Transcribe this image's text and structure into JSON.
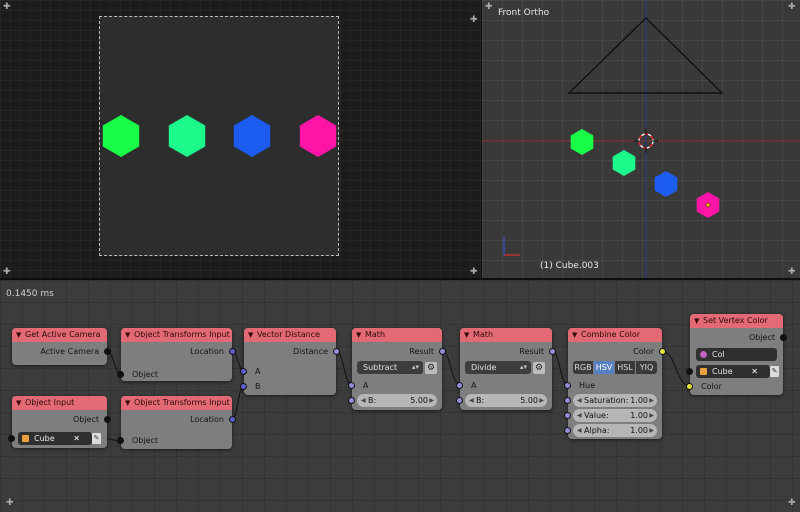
{
  "viewport_camera": {
    "hexagon_colors": [
      "#19ff47",
      "#1bfa8a",
      "#1c5cf0",
      "#ff14a8"
    ]
  },
  "viewport_ortho": {
    "view_label": "Front Ortho",
    "object_label": "(1) Cube.003",
    "hexagon_colors": [
      "#19ff47",
      "#1bfa8a",
      "#1c5cf0",
      "#ff14a8"
    ]
  },
  "node_editor": {
    "timing": "0.1450 ms",
    "nodes": {
      "get_active_camera": {
        "title": "Get Active Camera",
        "output": "Active Camera"
      },
      "object_input": {
        "title": "Object Input",
        "output": "Object",
        "object_value": "Cube"
      },
      "transforms_1": {
        "title": "Object Transforms Input",
        "output": "Location",
        "input": "Object"
      },
      "transforms_2": {
        "title": "Object Transforms Input",
        "output": "Location",
        "input": "Object"
      },
      "vector_distance": {
        "title": "Vector Distance",
        "output": "Distance",
        "input_a": "A",
        "input_b": "B"
      },
      "math_subtract": {
        "title": "Math",
        "output": "Result",
        "operation": "Subtract",
        "input_a": "A",
        "input_b_label": "B:",
        "input_b_value": "5.00"
      },
      "math_divide": {
        "title": "Math",
        "output": "Result",
        "operation": "Divide",
        "input_a": "A",
        "input_b_label": "B:",
        "input_b_value": "5.00"
      },
      "combine_color": {
        "title": "Combine Color",
        "output": "Color",
        "modes": [
          "RGB",
          "HSV",
          "HSL",
          "YIQ"
        ],
        "active_mode": "HSV",
        "hue_label": "Hue",
        "saturation_label": "Saturation:",
        "saturation_value": "1.00",
        "value_label": "Value:",
        "value_value": "1.00",
        "alpha_label": "Alpha:",
        "alpha_value": "1.00"
      },
      "set_vertex_color": {
        "title": "Set Vertex Color",
        "output": "Object",
        "layer_value": "Col",
        "object_value": "Cube",
        "input_color": "Color"
      }
    }
  }
}
